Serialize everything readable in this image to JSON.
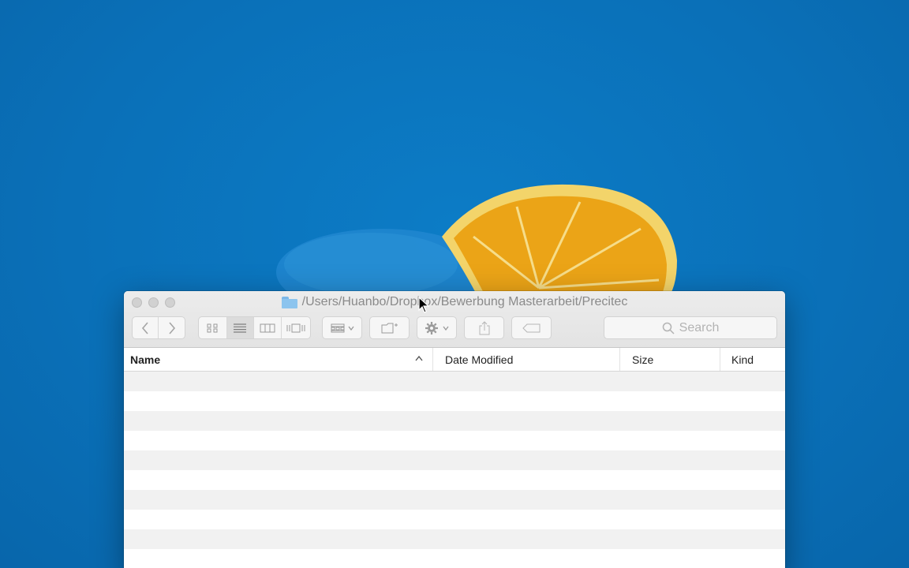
{
  "window": {
    "path": "/Users/Huanbo/Dropbox/Bewerbung Masterarbeit/Precitec",
    "folder_icon": "folder-icon"
  },
  "toolbar": {
    "back_icon": "chevron-left-icon",
    "forward_icon": "chevron-right-icon",
    "view_modes": [
      "icon-view",
      "list-view",
      "column-view",
      "cover-flow-view"
    ],
    "active_view": "list-view",
    "search_placeholder": "Search"
  },
  "columns": {
    "name": "Name",
    "date": "Date Modified",
    "size": "Size",
    "kind": "Kind",
    "sort_indicator": "^"
  },
  "colors": {
    "desktop_blue": "#0a74bd",
    "orange": "#f0a21a"
  }
}
